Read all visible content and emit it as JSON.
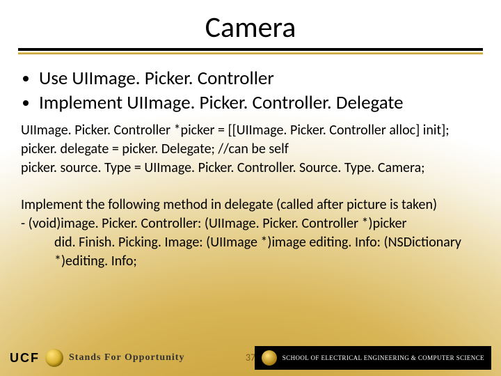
{
  "title": "Camera",
  "bullets": [
    "Use UIImage. Picker. Controller",
    "Implement UIImage. Picker. Controller. Delegate"
  ],
  "code_lines": [
    "UIImage. Picker. Controller *picker = [[UIImage. Picker. Controller alloc] init];",
    "picker. delegate = picker. Delegate;  //can be self",
    "picker. source. Type = UIImage. Picker. Controller. Source. Type. Camera;"
  ],
  "paragraph": {
    "intro": "Implement the following method in delegate (called after picture is taken)",
    "line2": "- (void)image. Picker. Controller: (UIImage. Picker. Controller *)picker",
    "line3": "did. Finish. Picking. Image: (UIImage *)image editing. Info: (NSDictionary *)editing. Info;"
  },
  "page_number": "37",
  "footer": {
    "ucf": "UCF",
    "tagline": "Stands For Opportunity",
    "dept": "SCHOOL OF ELECTRICAL ENGINEERING & COMPUTER SCIENCE"
  }
}
